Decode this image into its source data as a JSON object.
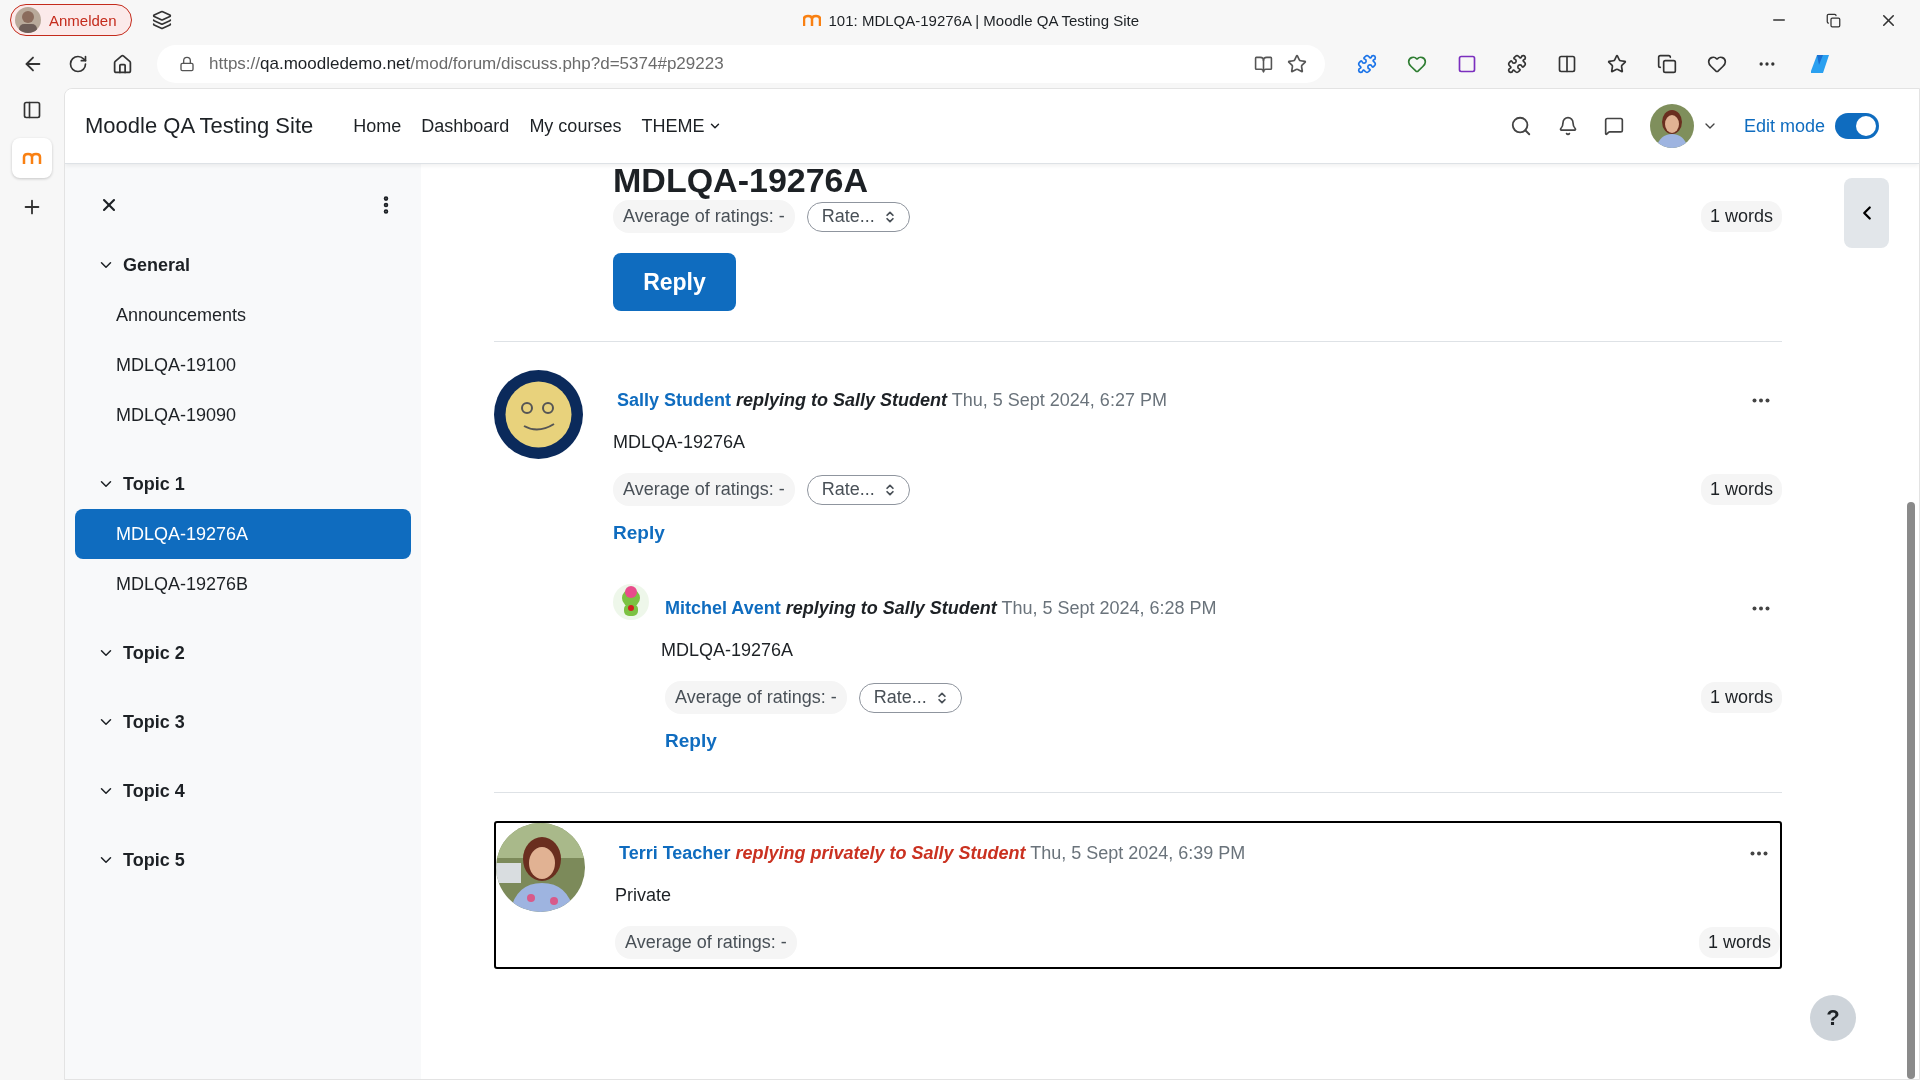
{
  "browser": {
    "profile_button": "Anmelden",
    "tab_title": "101: MDLQA-19276A | Moodle QA Testing Site",
    "url": {
      "scheme": "https://",
      "host": "qa.moodledemo.net",
      "path": "/mod/forum/discuss.php?d=5374#p29223"
    }
  },
  "navbar": {
    "site_name": "Moodle QA Testing Site",
    "links": [
      {
        "label": "Home",
        "kind": "link"
      },
      {
        "label": "Dashboard",
        "kind": "link"
      },
      {
        "label": "My courses",
        "kind": "link"
      },
      {
        "label": "THEME",
        "kind": "dropdown"
      }
    ],
    "edit_mode": {
      "label": "Edit mode",
      "on": true
    }
  },
  "course_index": {
    "sections": [
      {
        "title": "General",
        "expanded": true,
        "items": [
          {
            "label": "Announcements",
            "selected": false
          },
          {
            "label": "MDLQA-19100",
            "selected": false
          },
          {
            "label": "MDLQA-19090",
            "selected": false
          }
        ]
      },
      {
        "title": "Topic 1",
        "expanded": true,
        "items": [
          {
            "label": "MDLQA-19276A",
            "selected": true
          },
          {
            "label": "MDLQA-19276B",
            "selected": false
          }
        ]
      },
      {
        "title": "Topic 2",
        "expanded": true
      },
      {
        "title": "Topic 3",
        "expanded": true
      },
      {
        "title": "Topic 4",
        "expanded": true
      },
      {
        "title": "Topic 5",
        "expanded": true
      }
    ]
  },
  "discussion": {
    "heading": "MDLQA-19276A",
    "opening": {
      "average": "Average of ratings: -",
      "rate": "Rate...",
      "words": "1 words",
      "reply": "Reply"
    },
    "posts": [
      {
        "avatar": {
          "kind": "smiley"
        },
        "author": "Sally Student",
        "relation": "replying to Sally Student",
        "private": false,
        "date": "Thu, 5 Sept 2024, 6:27 PM",
        "body": "MDLQA-19276A",
        "average": "Average of ratings: -",
        "rate": "Rate...",
        "words": "1 words",
        "reply": "Reply",
        "children": [
          {
            "avatar": {
              "kind": "cartoon"
            },
            "author": "Mitchel Avent",
            "relation": "replying to Sally Student",
            "private": false,
            "date": "Thu, 5 Sept 2024, 6:28 PM",
            "body": "MDLQA-19276A",
            "average": "Average of ratings: -",
            "rate": "Rate...",
            "words": "1 words",
            "reply": "Reply"
          }
        ]
      },
      {
        "author": "Terri Teacher",
        "relation": "replying privately to Sally Student",
        "private": true,
        "date": "Thu, 5 Sept 2024, 6:39 PM",
        "body": "Private",
        "average": "Average of ratings: -",
        "words": "1 words"
      }
    ]
  },
  "help_button": "?"
}
